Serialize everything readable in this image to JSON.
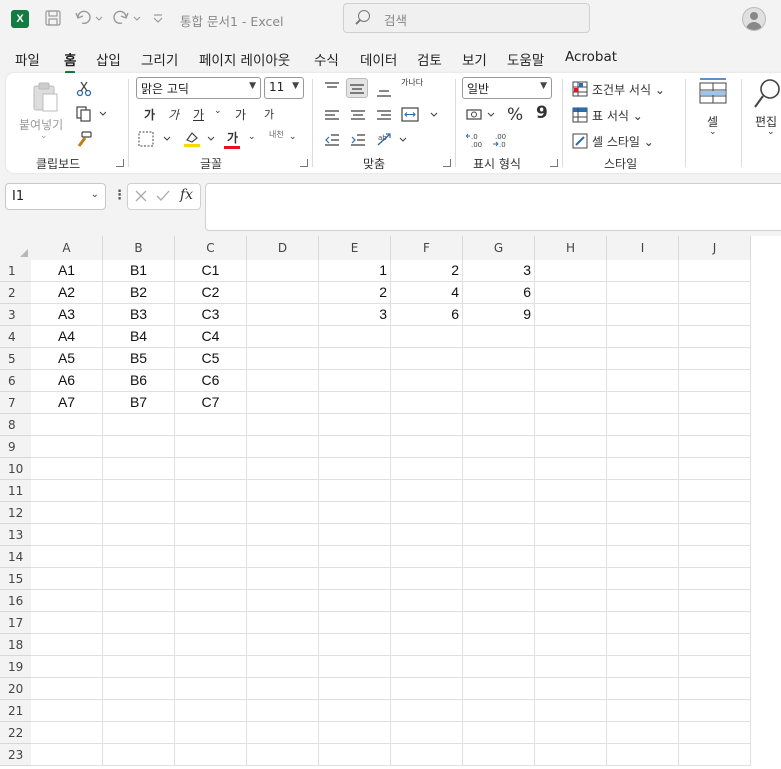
{
  "app": {
    "logo_letter": "X",
    "document_title": "통합 문서1",
    "app_name": "Excel",
    "title_sep": "-",
    "search_placeholder": "검색",
    "icons": [
      "excel-logo-icon",
      "save-icon",
      "undo-icon",
      "redo-icon",
      "customize-qat-icon",
      "search-icon",
      "account-icon"
    ]
  },
  "tabs": [
    {
      "label": "파일"
    },
    {
      "label": "홈",
      "active": true
    },
    {
      "label": "삽입"
    },
    {
      "label": "그리기"
    },
    {
      "label": "페이지 레이아웃"
    },
    {
      "label": "수식"
    },
    {
      "label": "데이터"
    },
    {
      "label": "검토"
    },
    {
      "label": "보기"
    },
    {
      "label": "도움말"
    },
    {
      "label": "Acrobat"
    }
  ],
  "ribbon": {
    "clipboard": {
      "paste_label": "붙여넣기",
      "group_label": "클립보드"
    },
    "font": {
      "font_name": "맑은 고딕",
      "font_size": "11",
      "bold": "가",
      "italic": "가",
      "underline": "가",
      "grow": "가",
      "shrink": "가",
      "phonetic": "내천",
      "font_color_glyph": "가",
      "group_label": "글꼴",
      "accent_colors": {
        "highlight": "#ffd700",
        "font_color": "#e81123"
      }
    },
    "alignment": {
      "wrap_glyph": "가나다",
      "group_label": "맞춤"
    },
    "number": {
      "format": "일반",
      "percent": "%",
      "comma": "9",
      "dec_inc": "←.0 .00",
      "dec_dec": ".00 →.0",
      "group_label": "표시 형식"
    },
    "styles": {
      "conditional": "조건부 서식",
      "table": "표 서식",
      "cell_styles": "셀 스타일",
      "group_label": "스타일"
    },
    "cells": {
      "label": "셀"
    },
    "editing": {
      "label": "편집"
    }
  },
  "formula_bar": {
    "name_box": "I1",
    "fx": "fx",
    "formula": ""
  },
  "columns": [
    "A",
    "B",
    "C",
    "D",
    "E",
    "F",
    "G",
    "H",
    "I",
    "J"
  ],
  "rows": [
    "1",
    "2",
    "3",
    "4",
    "5",
    "6",
    "7",
    "8",
    "9",
    "10",
    "11",
    "12",
    "13",
    "14",
    "15",
    "16",
    "17",
    "18",
    "19",
    "20",
    "21",
    "22",
    "23"
  ],
  "cells": {
    "A1": "A1",
    "B1": "B1",
    "C1": "C1",
    "E1": "1",
    "F1": "2",
    "G1": "3",
    "A2": "A2",
    "B2": "B2",
    "C2": "C2",
    "E2": "2",
    "F2": "4",
    "G2": "6",
    "A3": "A3",
    "B3": "B3",
    "C3": "C3",
    "E3": "3",
    "F3": "6",
    "G3": "9",
    "A4": "A4",
    "B4": "B4",
    "C4": "C4",
    "A5": "A5",
    "B5": "B5",
    "C5": "C5",
    "A6": "A6",
    "B6": "B6",
    "C6": "C6",
    "A7": "A7",
    "B7": "B7",
    "C7": "C7"
  },
  "colors": {
    "accent": "#107c41",
    "grid_line": "#e0e0e0",
    "header_bg": "#f3f3f3"
  }
}
